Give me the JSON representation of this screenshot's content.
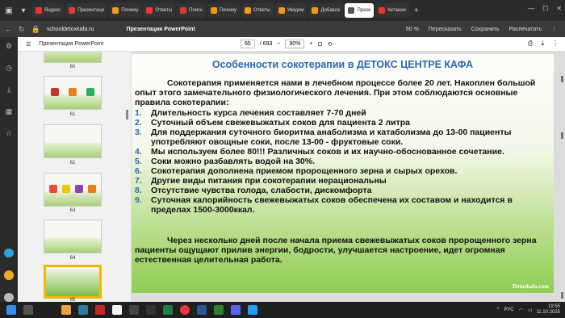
{
  "browser": {
    "tabs": [
      {
        "label": "Яндекс",
        "color": "#e53935"
      },
      {
        "label": "Презентаци",
        "color": "#e53935"
      },
      {
        "label": "Почему",
        "color": "#f39c12"
      },
      {
        "label": "Ответы",
        "color": "#e53935"
      },
      {
        "label": "Поиск",
        "color": "#e53935"
      },
      {
        "label": "Почему",
        "color": "#f39c12"
      },
      {
        "label": "Ответы",
        "color": "#f39c12"
      },
      {
        "label": "Уведом",
        "color": "#f39c12"
      },
      {
        "label": "Добавле",
        "color": "#f39c12"
      },
      {
        "label": "Презе",
        "color": "#555555",
        "active": true
      },
      {
        "label": "питание",
        "color": "#e53935"
      }
    ],
    "url": "schooldetoxkafa.ru",
    "page_title": "Презентация PowerPoint",
    "zoom": "90 %",
    "retell": "Пересказать",
    "save": "Сохранить",
    "print": "Распечатать"
  },
  "viewer": {
    "doc_title": "Презентация PowerPoint",
    "page_current": "65",
    "page_total": "/ 693",
    "zoom": "90%",
    "thumbnails": [
      "60",
      "61",
      "62",
      "63",
      "64",
      "65"
    ]
  },
  "slide": {
    "title": "Особенности сокотерапии в ДЕТОКС ЦЕНТРЕ КАФА",
    "intro": "Сокотерапия применяется нами в лечебном процессе более 20 лет. Накоплен большой опыт этого замечательного физиологического лечения. При этом соблюдаются основные правила сокотерапии:",
    "items": [
      {
        "num": "1.",
        "text": "Длительность курса лечения составляет 7-70 дней"
      },
      {
        "num": "2.",
        "text": "Суточный объем свежевыжатых соков для пациента 2 литра"
      },
      {
        "num": "3.",
        "text": "Для поддержания суточного биоритма анаболизма и катаболизма до 13-00 пациенты употребляют овощные соки, после 13-00 - фруктовые соки."
      },
      {
        "num": "4.",
        "text": "Мы используем более 80!!! Различных соков и их научно-обоснованное сочетание."
      },
      {
        "num": "5.",
        "text": "Соки можно разбавлять водой на 30%."
      },
      {
        "num": "6.",
        "text": "Сокотерапия дополнена приемом пророщенного зерна и сырых орехов."
      },
      {
        "num": "7.",
        "text": "Другие виды питания при сокотерапии нерациональны"
      },
      {
        "num": "8.",
        "text": "Отсутствие чувства голода, слабости, дискомфорта"
      },
      {
        "num": "9.",
        "text": "Суточная калорийность свежевыжатых соков обеспечена их составом и находится в пределах 1500-3000ккал."
      }
    ],
    "outro": "Через несколько дней после начала приема свежевыжатых соков пророщенного зерна пациенты ощущают прилив энергии, бодрости, улучшается настроение, идет огромная естественная целительная работа.",
    "watermark": "Detoxkafa.com"
  },
  "taskbar": {
    "time": "19:55",
    "date": "11.10.2025",
    "lang": "РУС"
  }
}
